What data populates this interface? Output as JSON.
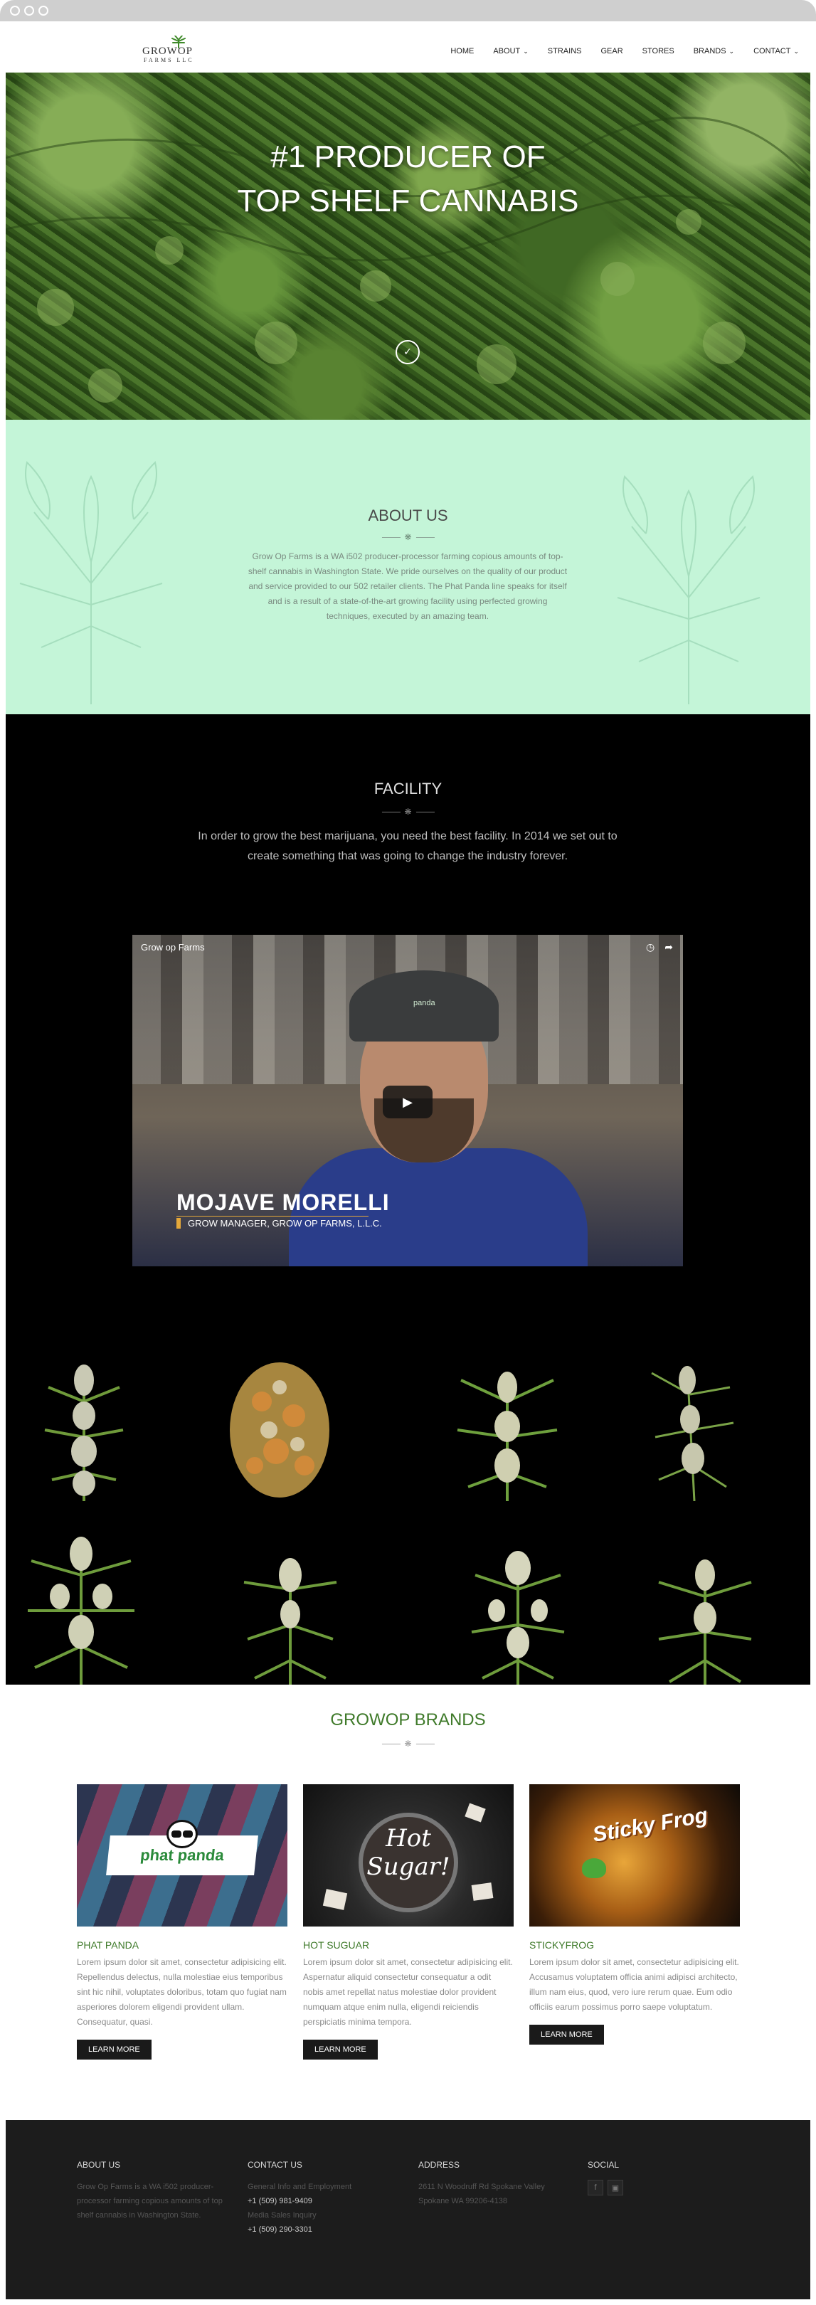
{
  "header": {
    "logo_main": "GROWOP",
    "logo_sub": "FARMS LLC",
    "nav": [
      {
        "label": "HOME",
        "dropdown": false
      },
      {
        "label": "ABOUT",
        "dropdown": true
      },
      {
        "label": "STRAINS",
        "dropdown": false
      },
      {
        "label": "GEAR",
        "dropdown": false
      },
      {
        "label": "STORES",
        "dropdown": false
      },
      {
        "label": "BRANDS",
        "dropdown": true
      },
      {
        "label": "CONTACT",
        "dropdown": true
      }
    ]
  },
  "hero": {
    "line1": "#1 PRODUCER OF",
    "line2": "TOP SHELF CANNABIS"
  },
  "about": {
    "title": "ABOUT US",
    "body": "Grow Op Farms is a WA i502 producer-processor farming copious amounts of top-shelf cannabis in Washington State. We pride ourselves on the quality of our product and service provided to our 502 retailer clients. The Phat Panda line speaks for itself and is a result of a state-of-the-art growing facility using perfected growing techniques, executed by an amazing team."
  },
  "facility": {
    "title": "FACILITY",
    "body": "In order to grow the best marijuana, you need the best facility. In 2014 we set out to create something that was going to change the industry forever.",
    "video": {
      "channel_title": "Grow op Farms",
      "person_name": "MOJAVE MORELLI",
      "person_role": "GROW MANAGER, GROW OP FARMS, L.L.C.",
      "cap_text": "panda"
    }
  },
  "brands": {
    "title": "GROWOP BRANDS",
    "items": [
      {
        "name": "PHAT PANDA",
        "image_text": "phat panda",
        "desc": "Lorem ipsum dolor sit amet, consectetur adipisicing elit. Repellendus delectus, nulla molestiae eius temporibus sint hic nihil, voluptates doloribus, totam quo fugiat nam asperiores dolorem eligendi provident ullam. Consequatur, quasi.",
        "button": "LEARN MORE"
      },
      {
        "name": "HOT SUGUAR",
        "image_text": "Hot Sugar!",
        "desc": "Lorem ipsum dolor sit amet, consectetur adipisicing elit. Aspernatur aliquid consectetur consequatur a odit nobis amet repellat natus molestiae dolor provident numquam atque enim nulla, eligendi reiciendis perspiciatis minima tempora.",
        "button": "LEARN MORE"
      },
      {
        "name": "STICKYFROG",
        "image_text": "Sticky Frog",
        "desc": "Lorem ipsum dolor sit amet, consectetur adipisicing elit. Accusamus voluptatem officia animi adipisci architecto, illum nam eius, quod, vero iure rerum quae. Eum odio officiis earum possimus porro saepe voluptatum.",
        "button": "LEARN MORE"
      }
    ]
  },
  "footer": {
    "about": {
      "title": "ABOUT US",
      "text": "Grow Op Farms is a WA i502 producer-processor farming copious amounts of top shelf cannabis in Washington State."
    },
    "contact": {
      "title": "CONTACT US",
      "general_label": "General Info and Employment",
      "general_phone": "+1 (509) 981-9409",
      "media_label": "Media Sales Inquiry",
      "media_phone": "+1 (509) 290-3301"
    },
    "address": {
      "title": "ADDRESS",
      "line1": "2611 N Woodruff Rd Spokane Valley",
      "line2": "Spokane WA 99206-4138"
    },
    "social": {
      "title": "SOCIAL",
      "icons": [
        "facebook-icon",
        "instagram-icon"
      ]
    }
  },
  "colors": {
    "about_bg": "#c4f5d8",
    "brand_green": "#3f7a2a",
    "footer_bg": "#1c1c1c"
  }
}
